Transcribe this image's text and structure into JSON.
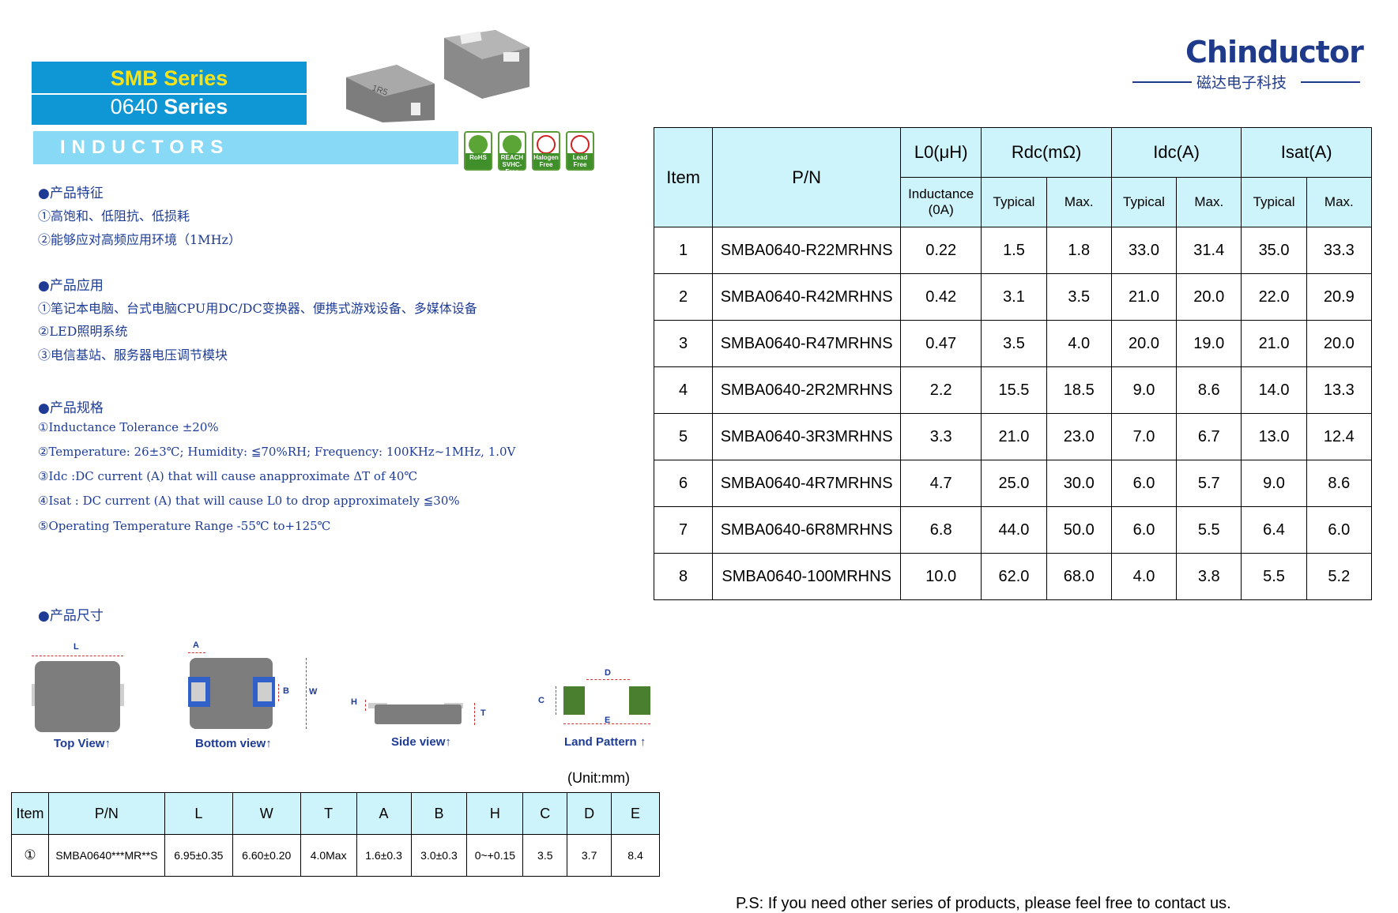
{
  "header": {
    "series_line1": "SMB Series",
    "series_line2_prefix": "0640 ",
    "series_line2_bold": "Series",
    "inductors": "INDUCTORS"
  },
  "badges": [
    {
      "label": "RoHS"
    },
    {
      "label": "REACH SVHC-Free"
    },
    {
      "label": "Halogen Free"
    },
    {
      "label": "Lead Free"
    }
  ],
  "logo": {
    "name": "Chinductor",
    "subtitle": "磁达电子科技"
  },
  "features": {
    "heading": "●产品特征",
    "items": [
      "①高饱和、低阻抗、低损耗",
      "②能够应对高频应用环境（1MHz）"
    ]
  },
  "applications": {
    "heading": "●产品应用",
    "items": [
      "①笔记本电脑、台式电脑CPU用DC/DC变换器、便携式游戏设备、多媒体设备",
      "②LED照明系统",
      "③电信基站、服务器电压调节模块"
    ]
  },
  "specs": {
    "heading": "●产品规格",
    "items": [
      "①Inductance Tolerance ±20%",
      "②Temperature: 26±3℃; Humidity: ≦70%RH; Frequency: 100KHz~1MHz, 1.0V",
      "③Idc :DC current (A) that will cause anapproximate ΔT of 40℃",
      "④Isat : DC current (A) that will cause L0 to drop approximately ≦30%",
      "⑤Operating Temperature Range -55℃ to+125℃"
    ]
  },
  "dimensions_heading": "●产品尺寸",
  "views": {
    "top": "Top View",
    "bottom": "Bottom view",
    "side": "Side view",
    "land": "Land Pattern",
    "marks": {
      "L": "L",
      "A": "A",
      "B": "B",
      "W": "W",
      "H": "H",
      "T": "T",
      "C": "C",
      "D": "D",
      "E": "E"
    }
  },
  "spec_table": {
    "headers": {
      "item": "Item",
      "pn": "P/N",
      "l0": "L0(μH)",
      "rdc": "Rdc(mΩ)",
      "idc": "Idc(A)",
      "isat": "Isat(A)",
      "inductance": "Inductance",
      "inductance_sub": "(0A)",
      "typical": "Typical",
      "max": "Max."
    },
    "rows": [
      [
        "1",
        "SMBA0640-R22MRHNS",
        "0.22",
        "1.5",
        "1.8",
        "33.0",
        "31.4",
        "35.0",
        "33.3"
      ],
      [
        "2",
        "SMBA0640-R42MRHNS",
        "0.42",
        "3.1",
        "3.5",
        "21.0",
        "20.0",
        "22.0",
        "20.9"
      ],
      [
        "3",
        "SMBA0640-R47MRHNS",
        "0.47",
        "3.5",
        "4.0",
        "20.0",
        "19.0",
        "21.0",
        "20.0"
      ],
      [
        "4",
        "SMBA0640-2R2MRHNS",
        "2.2",
        "15.5",
        "18.5",
        "9.0",
        "8.6",
        "14.0",
        "13.3"
      ],
      [
        "5",
        "SMBA0640-3R3MRHNS",
        "3.3",
        "21.0",
        "23.0",
        "7.0",
        "6.7",
        "13.0",
        "12.4"
      ],
      [
        "6",
        "SMBA0640-4R7MRHNS",
        "4.7",
        "25.0",
        "30.0",
        "6.0",
        "5.7",
        "9.0",
        "8.6"
      ],
      [
        "7",
        "SMBA0640-6R8MRHNS",
        "6.8",
        "44.0",
        "50.0",
        "6.0",
        "5.5",
        "6.4",
        "6.0"
      ],
      [
        "8",
        "SMBA0640-100MRHNS",
        "10.0",
        "62.0",
        "68.0",
        "4.0",
        "3.8",
        "5.5",
        "5.2"
      ]
    ]
  },
  "dim_table": {
    "unit": "(Unit:mm)",
    "headers": [
      "Item",
      "P/N",
      "L",
      "W",
      "T",
      "A",
      "B",
      "H",
      "C",
      "D",
      "E"
    ],
    "rows": [
      [
        "①",
        "SMBA0640***MR**S",
        "6.95±0.35",
        "6.60±0.20",
        "4.0Max",
        "1.6±0.3",
        "3.0±0.3",
        "0~+0.15",
        "3.5",
        "3.7",
        "8.4"
      ]
    ]
  },
  "footer": "P.S: If you need other series of products, please feel free to contact us.",
  "colors": {
    "blue": "#0f97d5",
    "yellow": "#f5e31a",
    "light_blue": "#87d9f5",
    "header_fill": "#cdf3fb",
    "text_blue": "#1e3c96",
    "pad_green": "#4a7f2f"
  }
}
